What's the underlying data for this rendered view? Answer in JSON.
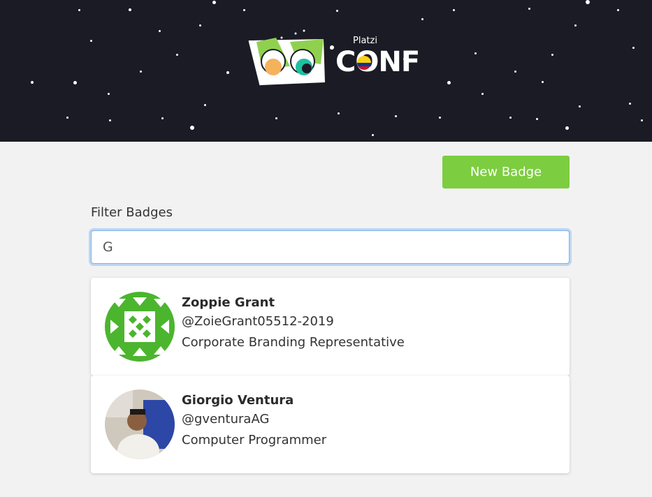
{
  "header": {
    "brand_small": "Platzi",
    "brand_big": "CONF"
  },
  "toolbar": {
    "new_badge_label": "New Badge"
  },
  "filter": {
    "label": "Filter Badges",
    "value": "G"
  },
  "badges": [
    {
      "name": "Zoppie Grant",
      "handle": "@ZoieGrant05512-2019",
      "job": "Corporate Branding Representative",
      "avatar_icon": "identicon-avatar"
    },
    {
      "name": "Giorgio Ventura",
      "handle": "@gventuraAG",
      "job": "Computer Programmer",
      "avatar_icon": "photo-avatar"
    }
  ],
  "colors": {
    "accent": "#7dcd40",
    "hero_bg": "#1b1b25",
    "focus_ring": "#7fb2ec"
  }
}
